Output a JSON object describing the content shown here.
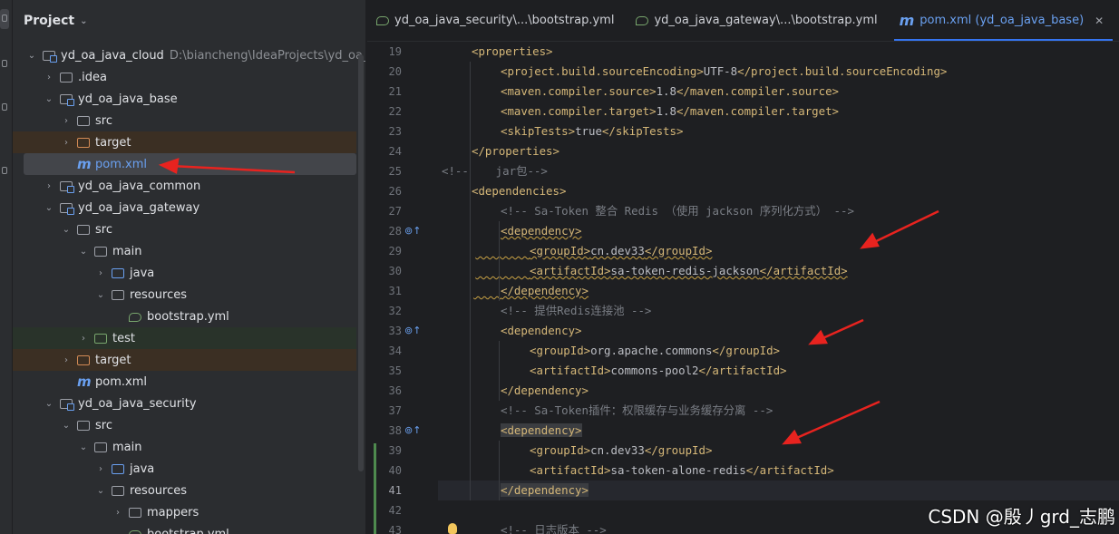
{
  "project_panel": {
    "title": "Project",
    "tree": [
      {
        "label": "yd_oa_java_cloud",
        "path": "D:\\biancheng\\IdeaProjects\\yd_oa_java",
        "type": "module",
        "depth": 0,
        "arrow": "⌄",
        "bold": true
      },
      {
        "label": ".idea",
        "type": "folder",
        "depth": 1,
        "arrow": "›"
      },
      {
        "label": "yd_oa_java_base",
        "type": "module",
        "depth": 1,
        "arrow": "⌄"
      },
      {
        "label": "src",
        "type": "folder",
        "depth": 2,
        "arrow": "›"
      },
      {
        "label": "target",
        "type": "folder-orange",
        "depth": 2,
        "arrow": "›",
        "bg": "dark-orange"
      },
      {
        "label": "pom.xml",
        "type": "maven",
        "depth": 2,
        "arrow": "",
        "selected": true
      },
      {
        "label": "yd_oa_java_common",
        "type": "module",
        "depth": 1,
        "arrow": "›"
      },
      {
        "label": "yd_oa_java_gateway",
        "type": "module",
        "depth": 1,
        "arrow": "⌄"
      },
      {
        "label": "src",
        "type": "folder",
        "depth": 2,
        "arrow": "⌄"
      },
      {
        "label": "main",
        "type": "folder",
        "depth": 3,
        "arrow": "⌄"
      },
      {
        "label": "java",
        "type": "folder-blue",
        "depth": 4,
        "arrow": "›"
      },
      {
        "label": "resources",
        "type": "folder-res",
        "depth": 4,
        "arrow": "⌄"
      },
      {
        "label": "bootstrap.yml",
        "type": "yml",
        "depth": 5,
        "arrow": ""
      },
      {
        "label": "test",
        "type": "folder-green",
        "depth": 3,
        "arrow": "›",
        "bg": "dark-green"
      },
      {
        "label": "target",
        "type": "folder-orange",
        "depth": 2,
        "arrow": "›",
        "bg": "dark-orange"
      },
      {
        "label": "pom.xml",
        "type": "maven",
        "depth": 2,
        "arrow": ""
      },
      {
        "label": "yd_oa_java_security",
        "type": "module",
        "depth": 1,
        "arrow": "⌄"
      },
      {
        "label": "src",
        "type": "folder",
        "depth": 2,
        "arrow": "⌄"
      },
      {
        "label": "main",
        "type": "folder",
        "depth": 3,
        "arrow": "⌄"
      },
      {
        "label": "java",
        "type": "folder-blue",
        "depth": 4,
        "arrow": "›"
      },
      {
        "label": "resources",
        "type": "folder-res",
        "depth": 4,
        "arrow": "⌄"
      },
      {
        "label": "mappers",
        "type": "folder",
        "depth": 5,
        "arrow": "›"
      },
      {
        "label": "bootstrap.yml",
        "type": "yml",
        "depth": 5,
        "arrow": ""
      }
    ]
  },
  "tabs": [
    {
      "label": "yd_oa_java_security\\...\\bootstrap.yml",
      "icon": "yml-icon",
      "active": false
    },
    {
      "label": "yd_oa_java_gateway\\...\\bootstrap.yml",
      "icon": "yml-icon",
      "active": false
    },
    {
      "label": "pom.xml (yd_oa_java_base)",
      "icon": "maven-icon",
      "active": true,
      "close": "✕"
    }
  ],
  "editor": {
    "lines": [
      {
        "n": "19",
        "indent": 1,
        "parts": [
          [
            "tag",
            "<properties>"
          ]
        ]
      },
      {
        "n": "20",
        "indent": 2,
        "parts": [
          [
            "tag",
            "<project.build.sourceEncoding>"
          ],
          [
            "txt",
            "UTF-8"
          ],
          [
            "tag",
            "</project.build.sourceEncoding>"
          ]
        ]
      },
      {
        "n": "21",
        "indent": 2,
        "parts": [
          [
            "tag",
            "<maven.compiler.source>"
          ],
          [
            "txt",
            "1.8"
          ],
          [
            "tag",
            "</maven.compiler.source>"
          ]
        ]
      },
      {
        "n": "22",
        "indent": 2,
        "parts": [
          [
            "tag",
            "<maven.compiler.target>"
          ],
          [
            "txt",
            "1.8"
          ],
          [
            "tag",
            "</maven.compiler.target>"
          ]
        ]
      },
      {
        "n": "23",
        "indent": 2,
        "parts": [
          [
            "tag",
            "<skipTests>"
          ],
          [
            "txt",
            "true"
          ],
          [
            "tag",
            "</skipTests>"
          ]
        ]
      },
      {
        "n": "24",
        "indent": 1,
        "parts": [
          [
            "tag",
            "</properties>"
          ]
        ]
      },
      {
        "n": "25",
        "indent": 0,
        "parts": [
          [
            "cmt",
            "<!--    jar包-->"
          ]
        ]
      },
      {
        "n": "26",
        "indent": 1,
        "parts": [
          [
            "tag",
            "<dependencies>"
          ]
        ]
      },
      {
        "n": "27",
        "indent": 2,
        "parts": [
          [
            "cmt",
            "<!-- Sa-Token 整合 Redis （使用 jackson 序列化方式） -->"
          ]
        ]
      },
      {
        "n": "28",
        "indent": 2,
        "mark": "⊚↑",
        "parts": [
          [
            "tag-sq",
            "<dependency>"
          ]
        ]
      },
      {
        "n": "29",
        "indent": 3,
        "squigfull": true,
        "parts": [
          [
            "tag",
            "<groupId>"
          ],
          [
            "txt",
            "cn.dev33"
          ],
          [
            "tag",
            "</groupId>"
          ]
        ]
      },
      {
        "n": "30",
        "indent": 3,
        "squigfull": true,
        "parts": [
          [
            "tag",
            "<artifactId>"
          ],
          [
            "txt",
            "sa-token-redis-jackson"
          ],
          [
            "tag",
            "</artifactId>"
          ]
        ]
      },
      {
        "n": "31",
        "indent": 2,
        "squigfull": true,
        "parts": [
          [
            "tag",
            "</dependency>"
          ]
        ]
      },
      {
        "n": "32",
        "indent": 2,
        "parts": [
          [
            "cmt",
            "<!-- 提供Redis连接池 -->"
          ]
        ]
      },
      {
        "n": "33",
        "indent": 2,
        "mark": "⊚↑",
        "parts": [
          [
            "tag",
            "<dependency>"
          ]
        ]
      },
      {
        "n": "34",
        "indent": 3,
        "parts": [
          [
            "tag",
            "<groupId>"
          ],
          [
            "txt",
            "org.apache.commons"
          ],
          [
            "tag",
            "</groupId>"
          ]
        ]
      },
      {
        "n": "35",
        "indent": 3,
        "parts": [
          [
            "tag",
            "<artifactId>"
          ],
          [
            "txt",
            "commons-pool2"
          ],
          [
            "tag",
            "</artifactId>"
          ]
        ]
      },
      {
        "n": "36",
        "indent": 2,
        "parts": [
          [
            "tag",
            "</dependency>"
          ]
        ]
      },
      {
        "n": "37",
        "indent": 2,
        "parts": [
          [
            "cmt",
            "<!-- Sa-Token插件：权限缓存与业务缓存分离 -->"
          ]
        ]
      },
      {
        "n": "38",
        "indent": 2,
        "mark": "⊚↑",
        "parts": [
          [
            "tag-hl",
            "<dependency>"
          ]
        ]
      },
      {
        "n": "39",
        "indent": 3,
        "parts": [
          [
            "tag",
            "<groupId>"
          ],
          [
            "txt",
            "cn.dev33"
          ],
          [
            "tag",
            "</groupId>"
          ]
        ]
      },
      {
        "n": "40",
        "indent": 3,
        "parts": [
          [
            "tag",
            "<artifactId>"
          ],
          [
            "txt",
            "sa-token-alone-redis"
          ],
          [
            "tag",
            "</artifactId>"
          ]
        ]
      },
      {
        "n": "41",
        "indent": 2,
        "current": true,
        "parts": [
          [
            "tag-hl",
            "</dependency>"
          ]
        ]
      },
      {
        "n": "42",
        "indent": 0,
        "parts": []
      },
      {
        "n": "43",
        "indent": 2,
        "parts": [
          [
            "cmt",
            "<!-- 日志版本 -->"
          ]
        ]
      }
    ]
  },
  "watermark": "CSDN @殷丿grd_志鹏",
  "colors": {
    "arrow_red": "#e8231f",
    "accent": "#3574f0"
  }
}
